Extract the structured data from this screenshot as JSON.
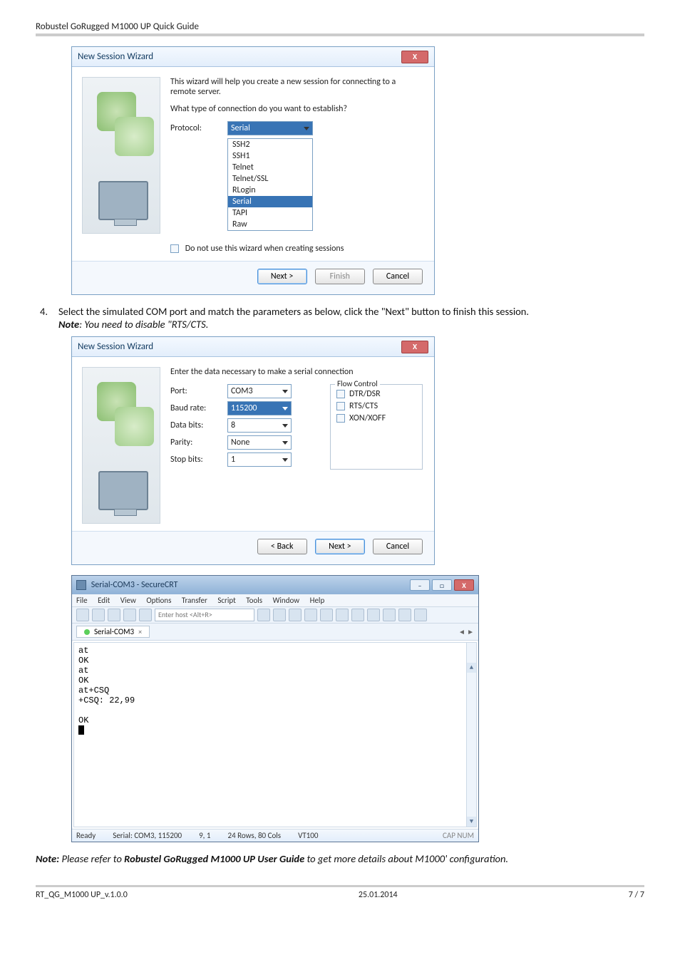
{
  "header": "Robustel GoRugged M1000 UP Quick Guide",
  "step4": {
    "num": "4.",
    "text": "Select the simulated COM port and match the parameters as below, click the \"Next\" button to finish this session.",
    "note_prefix": "Note",
    "note_rest": ": You need to disable \"RTS/CTS."
  },
  "final_note": {
    "prefix": "Note:",
    "mid1": " Please refer to ",
    "bold": "Robustel GoRugged M1000 UP User Guide",
    "mid2": " to get more details about M1000' configuration."
  },
  "dlg1": {
    "title": "New Session Wizard",
    "intro": "This wizard will help you create a new session for connecting to a remote server.",
    "q": "What type of connection do you want to establish?",
    "proto_lbl": "Protocol:",
    "proto_val": "Serial",
    "list": [
      "SSH2",
      "SSH1",
      "Telnet",
      "Telnet/SSL",
      "RLogin",
      "Serial",
      "TAPI",
      "Raw"
    ],
    "chk": "Do not use this wizard when creating sessions",
    "next": "Next >",
    "finish": "Finish",
    "cancel": "Cancel"
  },
  "dlg2": {
    "title": "New Session Wizard",
    "intro": "Enter the data necessary to make a serial connection",
    "port_lbl": "Port:",
    "port_val": "COM3",
    "baud_lbl": "Baud rate:",
    "baud_val": "115200",
    "data_lbl": "Data bits:",
    "data_val": "8",
    "parity_lbl": "Parity:",
    "parity_val": "None",
    "stop_lbl": "Stop bits:",
    "stop_val": "1",
    "flow_lbl": "Flow Control",
    "flow_dtr": "DTR/DSR",
    "flow_rts": "RTS/CTS",
    "flow_xon": "XON/XOFF",
    "back": "< Back",
    "next": "Next >",
    "cancel": "Cancel"
  },
  "crt": {
    "title": "Serial-COM3 - SecureCRT",
    "menu": [
      "File",
      "Edit",
      "View",
      "Options",
      "Transfer",
      "Script",
      "Tools",
      "Window",
      "Help"
    ],
    "host_ph": "Enter host <Alt+R>",
    "tab": "Serial-COM3",
    "term": "at\nOK\nat\nOK\nat+CSQ\n+CSQ: 22,99\n\nOK",
    "status_ready": "Ready",
    "status_port": "Serial: COM3, 115200",
    "status_pos": "9,  1",
    "status_size": "24 Rows, 80 Cols",
    "status_emu": "VT100",
    "status_caps": "CAP  NUM"
  },
  "footer": {
    "left": "RT_QG_M1000 UP_v.1.0.0",
    "center": "25.01.2014",
    "right": "7 / 7"
  }
}
